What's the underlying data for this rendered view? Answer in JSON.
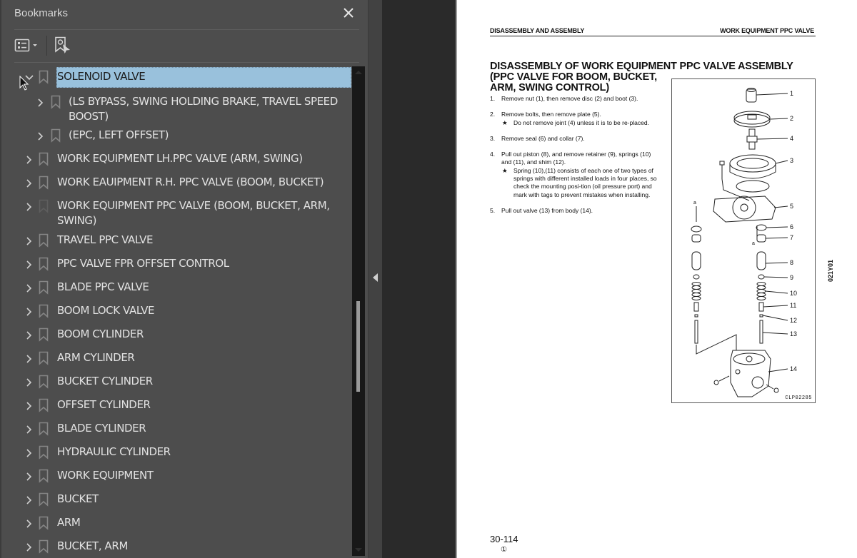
{
  "panel": {
    "title": "Bookmarks",
    "close_icon": "close-icon",
    "toolbar": {
      "options_icon": "bookmark-options-icon",
      "find_icon": "find-current-bookmark-icon"
    }
  },
  "bookmarks": [
    {
      "label": "SOLENOID VALVE",
      "level": 0,
      "expanded": true,
      "selected": true
    },
    {
      "label": "(LS BYPASS, SWING HOLDING BRAKE, TRAVEL SPEED",
      "label2": "BOOST)",
      "level": 1,
      "expanded": false
    },
    {
      "label": "(EPC, LEFT OFFSET)",
      "level": 1,
      "expanded": false
    },
    {
      "label": "WORK EQUIPMENT LH.PPC VALVE (ARM, SWING)",
      "level": 0,
      "expanded": false
    },
    {
      "label": "WORK EAUIPMENT R.H. PPC VALVE (BOOM, BUCKET)",
      "level": 0,
      "expanded": false
    },
    {
      "label": "WORK EQUIPMENT PPC VALVE (BOOM, BUCKET, ARM,",
      "label2": "SWING)",
      "level": 0,
      "expanded": false
    },
    {
      "label": "TRAVEL PPC VALVE",
      "level": 0,
      "expanded": false
    },
    {
      "label": "PPC VALVE FPR OFFSET CONTROL",
      "level": 0,
      "expanded": false
    },
    {
      "label": "BLADE PPC VALVE",
      "level": 0,
      "expanded": false
    },
    {
      "label": "BOOM LOCK VALVE",
      "level": 0,
      "expanded": false
    },
    {
      "label": "BOOM CYLINDER",
      "level": 0,
      "expanded": false
    },
    {
      "label": "ARM CYLINDER",
      "level": 0,
      "expanded": false
    },
    {
      "label": "BUCKET CYLINDER",
      "level": 0,
      "expanded": false
    },
    {
      "label": "OFFSET CYLINDER",
      "level": 0,
      "expanded": false
    },
    {
      "label": "BLADE CYLINDER",
      "level": 0,
      "expanded": false
    },
    {
      "label": "HYDRAULIC CYLINDER",
      "level": 0,
      "expanded": false
    },
    {
      "label": "WORK EQUIPMENT",
      "level": 0,
      "expanded": false
    },
    {
      "label": "BUCKET",
      "level": 0,
      "expanded": false
    },
    {
      "label": "ARM",
      "level": 0,
      "expanded": false
    },
    {
      "label": "BUCKET, ARM",
      "level": 0,
      "expanded": false
    }
  ],
  "scrollbar": {
    "position_fraction": 0.48,
    "visible_fraction": 0.19
  },
  "document": {
    "header_left": "DISASSEMBLY AND ASSEMBLY",
    "header_right": "WORK EQUIPMENT PPC VALVE",
    "title_lines": [
      "DISASSEMBLY OF WORK EQUIPMENT PPC VALVE ASSEMBLY",
      "(PPC VALVE FOR BOOM, BUCKET,",
      "ARM, SWING CONTROL)"
    ],
    "steps": [
      {
        "num": "1.",
        "text": "Remove nut (1), then remove disc (2) and boot (3)."
      },
      {
        "num": "2.",
        "text": "Remove bolts, then remove plate (5).",
        "note": "Do not remove joint (4) unless it is to be re-placed."
      },
      {
        "num": "3.",
        "text": "Remove seal (6) and collar (7)."
      },
      {
        "num": "4.",
        "text": "Pull out piston (8), and remove retainer (9), springs (10) and (11), and shim (12).",
        "note": "Spring (10),(11) consists of each one of two types of springs with different installed loads in four places, so check the mounting posi-tion (oil pressure port) and mark with tags to prevent mistakes when installing."
      },
      {
        "num": "5.",
        "text": "Pull out valve (13) from body (14)."
      }
    ],
    "note_symbol": "★",
    "figure_callouts": [
      "1",
      "2",
      "4",
      "3",
      "5",
      "6",
      "7",
      "8",
      "9",
      "10",
      "11",
      "12",
      "13",
      "14"
    ],
    "figure_marker": "a",
    "figure_code": "CLP02285",
    "side_code": "021Y01",
    "page_number": "30-114",
    "revision_mark": "①"
  }
}
